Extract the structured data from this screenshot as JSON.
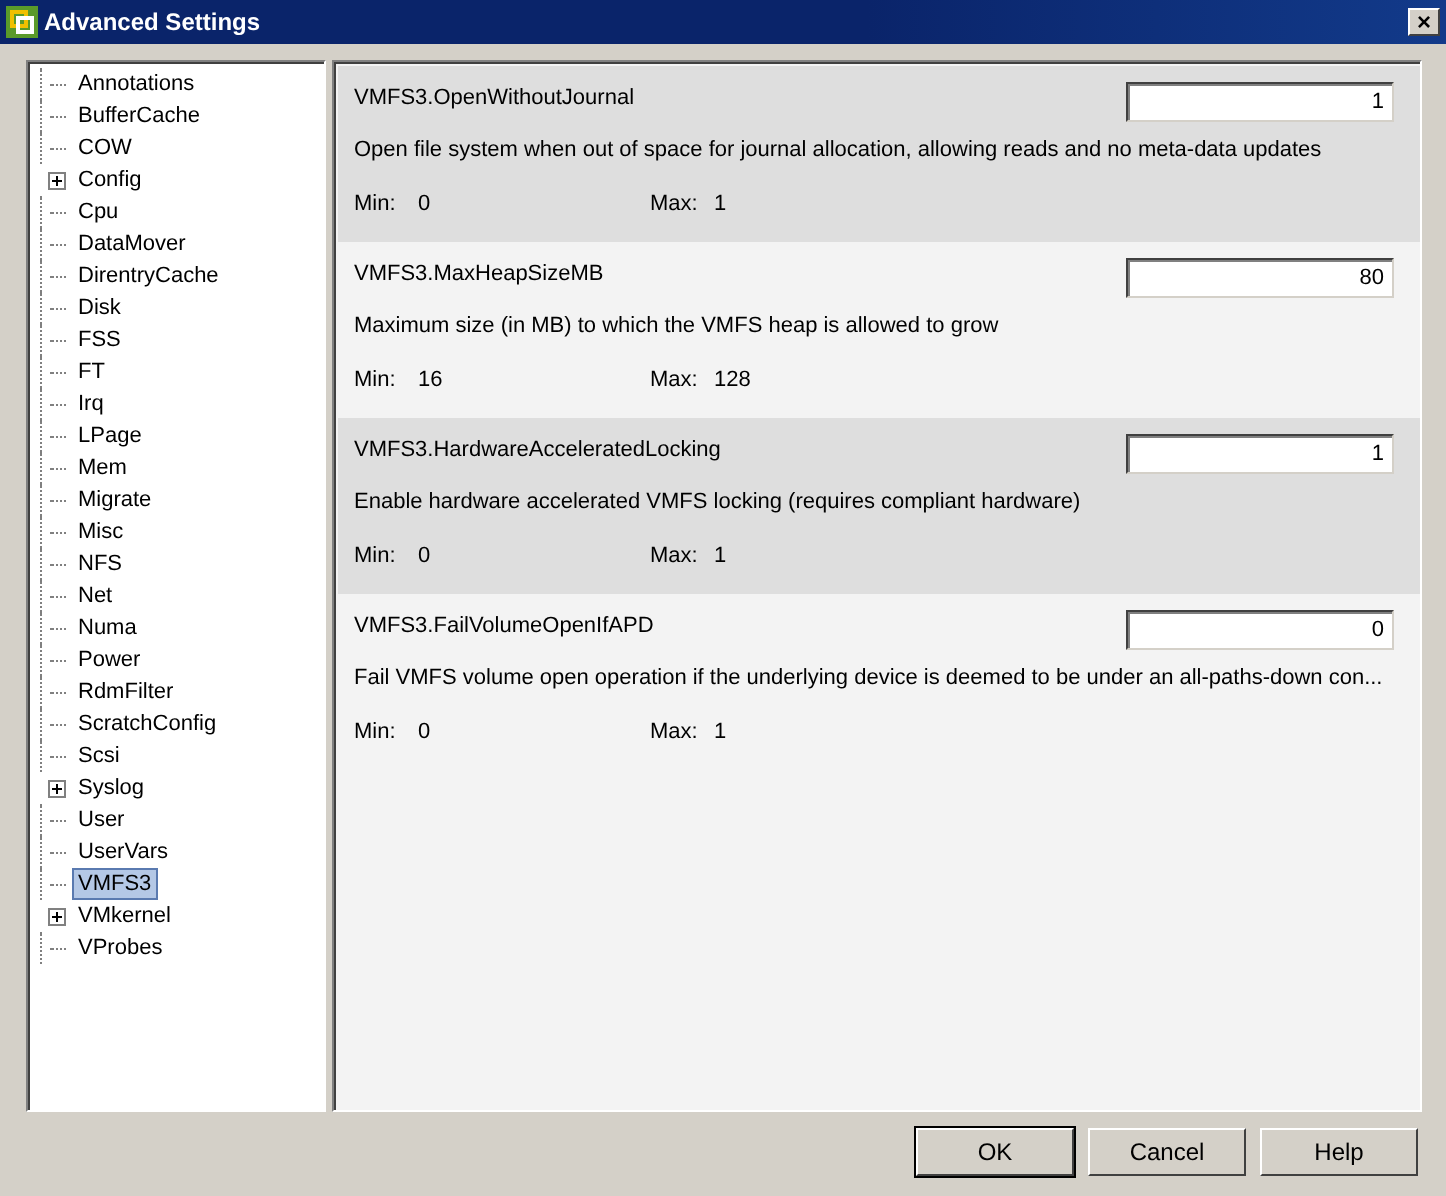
{
  "window": {
    "title": "Advanced Settings",
    "close": "×"
  },
  "tree": [
    {
      "label": "Annotations",
      "expandable": false,
      "selected": false
    },
    {
      "label": "BufferCache",
      "expandable": false,
      "selected": false
    },
    {
      "label": "COW",
      "expandable": false,
      "selected": false
    },
    {
      "label": "Config",
      "expandable": true,
      "selected": false
    },
    {
      "label": "Cpu",
      "expandable": false,
      "selected": false
    },
    {
      "label": "DataMover",
      "expandable": false,
      "selected": false
    },
    {
      "label": "DirentryCache",
      "expandable": false,
      "selected": false
    },
    {
      "label": "Disk",
      "expandable": false,
      "selected": false
    },
    {
      "label": "FSS",
      "expandable": false,
      "selected": false
    },
    {
      "label": "FT",
      "expandable": false,
      "selected": false
    },
    {
      "label": "Irq",
      "expandable": false,
      "selected": false
    },
    {
      "label": "LPage",
      "expandable": false,
      "selected": false
    },
    {
      "label": "Mem",
      "expandable": false,
      "selected": false
    },
    {
      "label": "Migrate",
      "expandable": false,
      "selected": false
    },
    {
      "label": "Misc",
      "expandable": false,
      "selected": false
    },
    {
      "label": "NFS",
      "expandable": false,
      "selected": false
    },
    {
      "label": "Net",
      "expandable": false,
      "selected": false
    },
    {
      "label": "Numa",
      "expandable": false,
      "selected": false
    },
    {
      "label": "Power",
      "expandable": false,
      "selected": false
    },
    {
      "label": "RdmFilter",
      "expandable": false,
      "selected": false
    },
    {
      "label": "ScratchConfig",
      "expandable": false,
      "selected": false
    },
    {
      "label": "Scsi",
      "expandable": false,
      "selected": false
    },
    {
      "label": "Syslog",
      "expandable": true,
      "selected": false
    },
    {
      "label": "User",
      "expandable": false,
      "selected": false
    },
    {
      "label": "UserVars",
      "expandable": false,
      "selected": false
    },
    {
      "label": "VMFS3",
      "expandable": false,
      "selected": true
    },
    {
      "label": "VMkernel",
      "expandable": true,
      "selected": false
    },
    {
      "label": "VProbes",
      "expandable": false,
      "selected": false
    }
  ],
  "settings": [
    {
      "name": "VMFS3.OpenWithoutJournal",
      "value": "1",
      "description": "Open file system when out of space for journal allocation, allowing reads and no meta-data updates",
      "min_label": "Min:",
      "min": "0",
      "max_label": "Max:",
      "max": "1"
    },
    {
      "name": "VMFS3.MaxHeapSizeMB",
      "value": "80",
      "description": "Maximum size (in MB) to which the VMFS heap is allowed to grow",
      "min_label": "Min:",
      "min": "16",
      "max_label": "Max:",
      "max": "128"
    },
    {
      "name": "VMFS3.HardwareAcceleratedLocking",
      "value": "1",
      "description": "Enable hardware accelerated VMFS locking (requires compliant hardware)",
      "min_label": "Min:",
      "min": "0",
      "max_label": "Max:",
      "max": "1"
    },
    {
      "name": "VMFS3.FailVolumeOpenIfAPD",
      "value": "0",
      "description": "Fail VMFS volume open operation if the underlying device is deemed to be under an all-paths-down con...",
      "min_label": "Min:",
      "min": "0",
      "max_label": "Max:",
      "max": "1"
    }
  ],
  "buttons": [
    {
      "label": "OK",
      "default": true
    },
    {
      "label": "Cancel",
      "default": false
    },
    {
      "label": "Help",
      "default": false
    }
  ]
}
